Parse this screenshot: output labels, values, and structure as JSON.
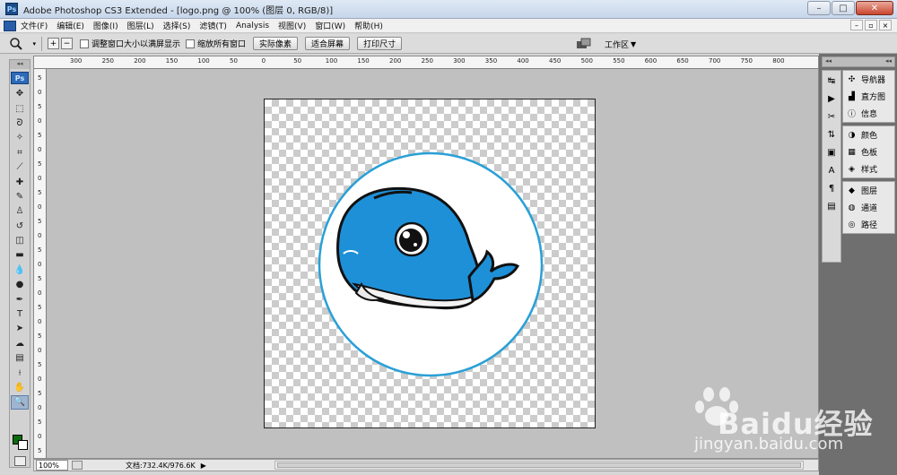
{
  "window": {
    "title": "Adobe Photoshop CS3 Extended - [logo.png @ 100% (图层 0, RGB/8)]",
    "controls": {
      "minimize": "–",
      "maximize": "□",
      "close": "✕"
    }
  },
  "menubar": {
    "items": [
      "文件(F)",
      "编辑(E)",
      "图像(I)",
      "图层(L)",
      "选择(S)",
      "滤镜(T)",
      "Analysis",
      "视图(V)",
      "窗口(W)",
      "帮助(H)"
    ],
    "doc_controls": [
      "–",
      "▫",
      "×"
    ]
  },
  "optionsbar": {
    "checkbox_resize": "调整窗口大小以满屏显示",
    "checkbox_zoom_all": "缩放所有窗口",
    "btn_actual": "实际像素",
    "btn_fit": "适合屏幕",
    "btn_print": "打印尺寸",
    "workspace": "工作区"
  },
  "toolbox": {
    "logo": "Ps",
    "tools": [
      {
        "name": "move-tool",
        "glyph": "✥"
      },
      {
        "name": "marquee-tool",
        "glyph": "⬚"
      },
      {
        "name": "lasso-tool",
        "glyph": "ᘐ"
      },
      {
        "name": "magic-wand-tool",
        "glyph": "✧"
      },
      {
        "name": "crop-tool",
        "glyph": "⌗"
      },
      {
        "name": "slice-tool",
        "glyph": "⟋"
      },
      {
        "name": "healing-brush-tool",
        "glyph": "✚"
      },
      {
        "name": "brush-tool",
        "glyph": "✎"
      },
      {
        "name": "clone-stamp-tool",
        "glyph": "♙"
      },
      {
        "name": "history-brush-tool",
        "glyph": "↺"
      },
      {
        "name": "eraser-tool",
        "glyph": "◫"
      },
      {
        "name": "gradient-tool",
        "glyph": "▬"
      },
      {
        "name": "blur-tool",
        "glyph": "💧"
      },
      {
        "name": "dodge-tool",
        "glyph": "●"
      },
      {
        "name": "pen-tool",
        "glyph": "✒"
      },
      {
        "name": "type-tool",
        "glyph": "T"
      },
      {
        "name": "path-selection-tool",
        "glyph": "➤"
      },
      {
        "name": "shape-tool",
        "glyph": "☁"
      },
      {
        "name": "notes-tool",
        "glyph": "▤"
      },
      {
        "name": "eyedropper-tool",
        "glyph": "⟊"
      },
      {
        "name": "hand-tool",
        "glyph": "✋"
      },
      {
        "name": "zoom-tool",
        "glyph": "🔍"
      }
    ]
  },
  "ruler": {
    "top_labels": [
      "300",
      "250",
      "200",
      "150",
      "100",
      "50",
      "0",
      "50",
      "100",
      "150",
      "200",
      "250",
      "300",
      "350",
      "400",
      "450",
      "500",
      "550",
      "600",
      "650",
      "700",
      "750",
      "800"
    ],
    "left_labels": [
      "5",
      "0",
      "5",
      "0",
      "5",
      "0",
      "5",
      "0",
      "5",
      "0",
      "5",
      "0",
      "5",
      "0",
      "5",
      "0",
      "5",
      "0",
      "5",
      "0",
      "5",
      "0",
      "5",
      "0",
      "5",
      "0",
      "5"
    ]
  },
  "status": {
    "zoom": "100%",
    "doc_info": "文档:732.4K/976.6K",
    "arrow": "▶"
  },
  "panels": {
    "groups": [
      [
        {
          "icon": "✣",
          "label": "导航器"
        },
        {
          "icon": "▟",
          "label": "直方图"
        },
        {
          "icon": "ⓘ",
          "label": "信息"
        }
      ],
      [
        {
          "icon": "◑",
          "label": "颜色"
        },
        {
          "icon": "▦",
          "label": "色板"
        },
        {
          "icon": "◈",
          "label": "样式"
        }
      ],
      [
        {
          "icon": "◆",
          "label": "图层"
        },
        {
          "icon": "◍",
          "label": "通道"
        },
        {
          "icon": "◎",
          "label": "路径"
        }
      ]
    ],
    "dock_icons": [
      "↹",
      "▶",
      "✂",
      "⇅",
      "▣",
      "A",
      "¶",
      "▤"
    ]
  },
  "watermark": {
    "brand": "Baidu经验",
    "url": "jingyan.baidu.com"
  },
  "colors": {
    "foreground": "#0a6b0a",
    "whale_blue": "#1e90d8",
    "circle_stroke": "#2aa0d6"
  }
}
